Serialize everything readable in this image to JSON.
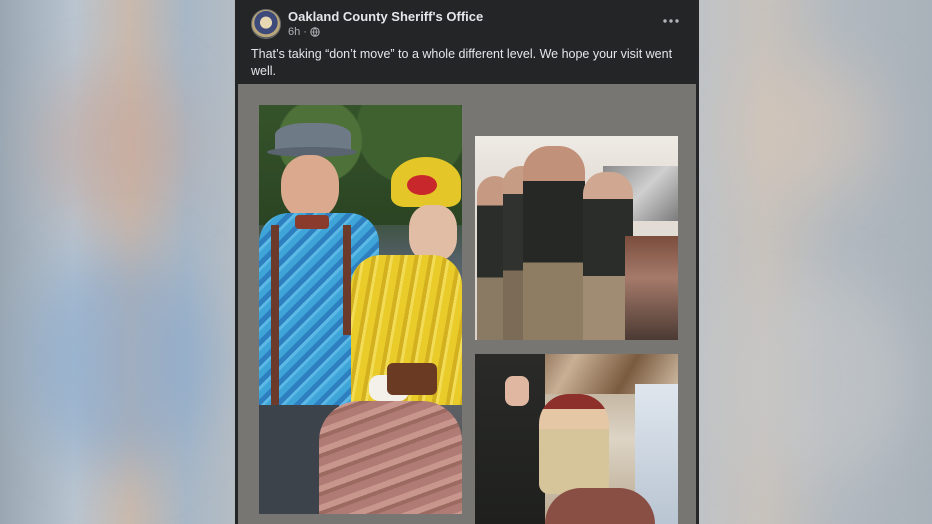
{
  "post": {
    "author": "Oakland County Sheriff's Office",
    "time": "6h",
    "separator": "·",
    "text": "That’s taking “don’t move” to a whole different level. We hope your visit went well.",
    "emoji_text": "👮",
    "icons": {
      "avatar": "sheriff-badge-avatar",
      "privacy": "globe-icon",
      "more": "more-options-icon"
    }
  },
  "colors": {
    "post_background": "#242526",
    "text_primary": "#e4e6eb",
    "text_secondary": "#b0b3b8",
    "media_background": "#787672"
  }
}
